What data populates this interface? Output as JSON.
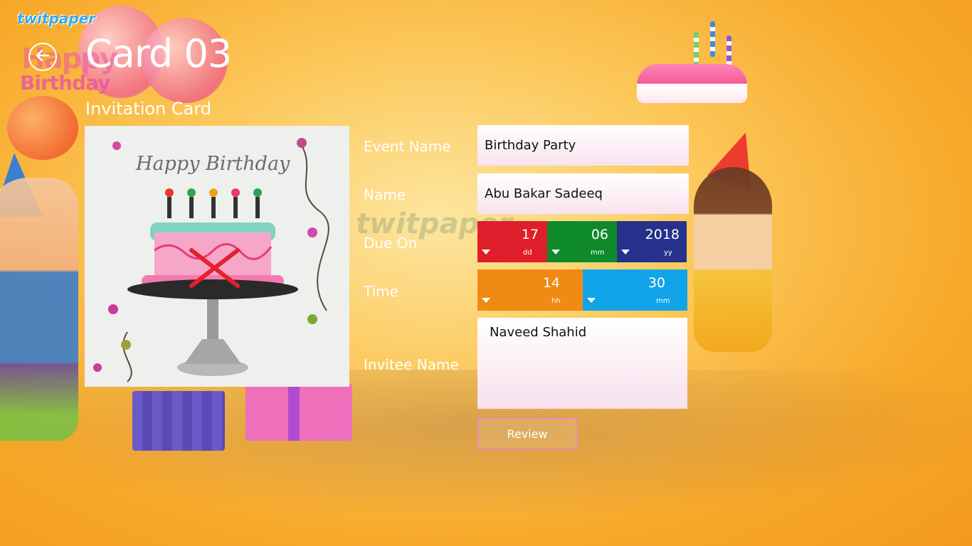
{
  "app": {
    "brand": "twitpaper"
  },
  "header": {
    "title": "Card 03",
    "subtitle": "Invitation Card",
    "back_icon": "back-arrow-icon"
  },
  "card_preview": {
    "caption": "Happy Birthday"
  },
  "background": {
    "greeting_line1": "Happy",
    "greeting_line2": "Birthday",
    "watermark": "twitpaper"
  },
  "form": {
    "event_name": {
      "label": "Event Name",
      "value": "Birthday Party"
    },
    "name": {
      "label": "Name",
      "value": "Abu Bakar Sadeeq"
    },
    "due_on": {
      "label": "Due On",
      "day": {
        "value": "17",
        "unit": "dd",
        "color": "#e01e2b"
      },
      "month": {
        "value": "06",
        "unit": "mm",
        "color": "#0f8a2a"
      },
      "year": {
        "value": "2018",
        "unit": "yy",
        "color": "#25318a"
      }
    },
    "time": {
      "label": "Time",
      "hour": {
        "value": "14",
        "unit": "hh",
        "color": "#f08a12"
      },
      "minute": {
        "value": "30",
        "unit": "mm",
        "color": "#12a4e8"
      }
    },
    "invitee_name": {
      "label": "Invitee Name",
      "value": "Naveed Shahid"
    },
    "review_label": "Review"
  },
  "colors": {
    "accent_border": "#f28ac0",
    "background": "#f7a92a"
  }
}
